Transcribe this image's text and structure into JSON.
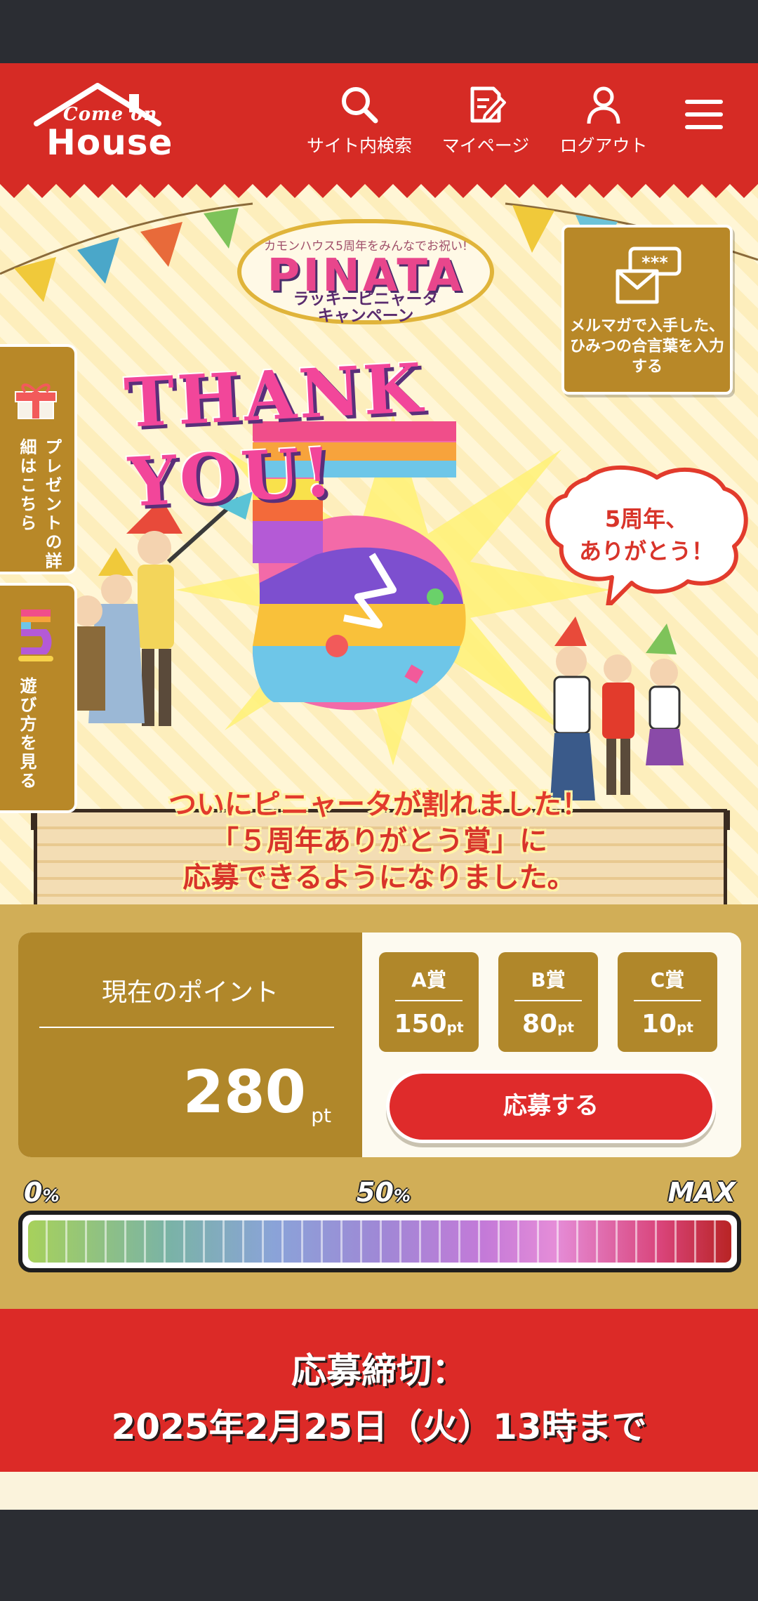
{
  "header": {
    "logo_line1": "Come on",
    "logo_line2": "House",
    "nav": [
      {
        "label": "サイト内検索",
        "icon": "search-icon"
      },
      {
        "label": "マイページ",
        "icon": "edit-document-icon"
      },
      {
        "label": "ログアウト",
        "icon": "user-icon"
      }
    ],
    "menu_icon": "hamburger-menu-icon"
  },
  "hero": {
    "campaign_subtitle": "カモンハウス5周年をみんなでお祝い!",
    "campaign_title": "PINATA",
    "campaign_name_1": "ラッキーピニャータ",
    "campaign_name_2": "キャンペーン",
    "thank_you": "THANK YOU!",
    "side_tabs": [
      {
        "label": "プレゼントの詳細はこちら",
        "icon": "gift-icon"
      },
      {
        "label": "遊び方を見る",
        "icon": "five-anniversary-icon"
      }
    ],
    "mail_box_label": "メルマガで入手した、ひみつの合言葉を入力する",
    "mail_box_icon": "secret-mail-icon",
    "bubble_text_1": "5周年、",
    "bubble_text_2": "ありがとう！",
    "message_1": "ついにピニャータが割れました！",
    "message_2": "「５周年ありがとう賞」に",
    "message_3": "応募できるようになりました。"
  },
  "points": {
    "title": "現在のポイント",
    "value": "280",
    "unit": "pt",
    "prizes": [
      {
        "name": "A賞",
        "value": "150",
        "unit": "pt"
      },
      {
        "name": "B賞",
        "value": "80",
        "unit": "pt"
      },
      {
        "name": "C賞",
        "value": "10",
        "unit": "pt"
      }
    ],
    "apply_label": "応募する"
  },
  "gauge": {
    "label_start": "0",
    "label_mid": "50",
    "label_percent": "%",
    "label_end": "MAX",
    "fill_fraction": 1.0
  },
  "deadline": {
    "line1": "応募締切：",
    "line2": "2025年2月25日（火）13時まで"
  },
  "colors": {
    "header_red": "#d62b25",
    "gold": "#b0872a",
    "panel_gold": "#d1ae57",
    "button_red": "#df2b2b"
  }
}
